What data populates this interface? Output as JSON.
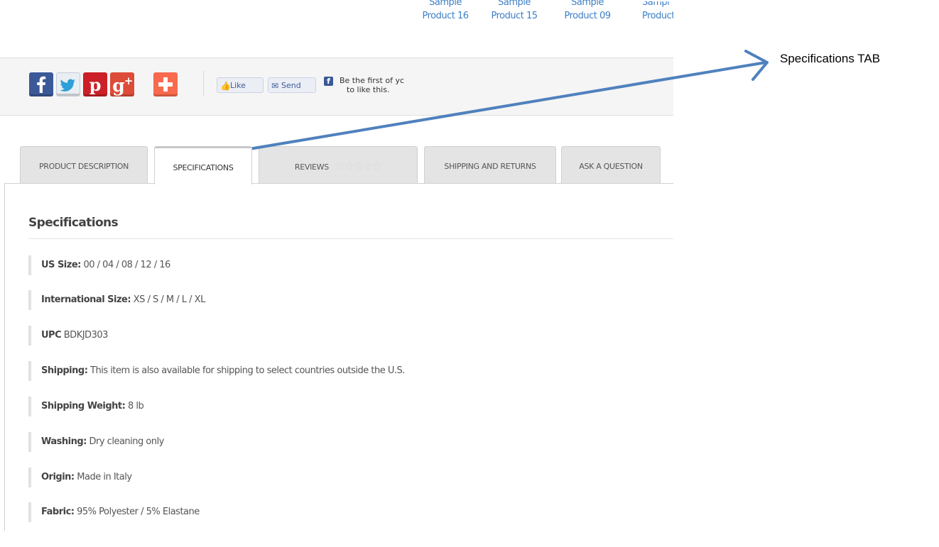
{
  "related_products": [
    {
      "line1": "Sample",
      "line2": "Product 16"
    },
    {
      "line1": "Sample",
      "line2": "Product 15"
    },
    {
      "line1": "Sample",
      "line2": "Product 09"
    },
    {
      "line1": "Sampl",
      "line2": "Product"
    }
  ],
  "share": {
    "icons": [
      "facebook-icon",
      "twitter-icon",
      "pinterest-icon",
      "google-plus-icon",
      "addthis-plus-icon"
    ],
    "like_label": "Like",
    "send_label": "Send",
    "fb_text_line1": "Be the first of yc",
    "fb_text_line2": "to like this.",
    "colors": {
      "facebook": "#3b5998",
      "twitter": "#e9eef3",
      "pinterest": "#cb2027",
      "google_plus": "#dd4b39",
      "addthis": "#f8694d"
    }
  },
  "tabs": [
    {
      "label": "PRODUCT DESCRIPTION"
    },
    {
      "label": "SPECIFICATIONS",
      "active": true
    },
    {
      "label": "REVIEWS",
      "stars": "☆☆☆☆☆"
    },
    {
      "label": "SHIPPING AND RETURNS"
    },
    {
      "label": "ASK A QUESTION"
    }
  ],
  "specifications": {
    "title": "Specifications",
    "rows": [
      {
        "label": "US Size:",
        "value": "00 / 04 / 08 / 12 / 16"
      },
      {
        "label": "International Size:",
        "value": "XS / S / M / L / XL"
      },
      {
        "label": "UPC",
        "value": "BDKJD303"
      },
      {
        "label": "Shipping:",
        "value": "This item is also available for shipping to select countries outside the U.S."
      },
      {
        "label": "Shipping Weight:",
        "value": "8 lb"
      },
      {
        "label": "Washing:",
        "value": "Dry cleaning only"
      },
      {
        "label": "Origin:",
        "value": "Made in Italy"
      },
      {
        "label": "Fabric:",
        "value": "95% Polyester / 5% Elastane"
      }
    ]
  },
  "annotation": {
    "text": "Specifications TAB",
    "arrow_color": "#4f81bd"
  }
}
